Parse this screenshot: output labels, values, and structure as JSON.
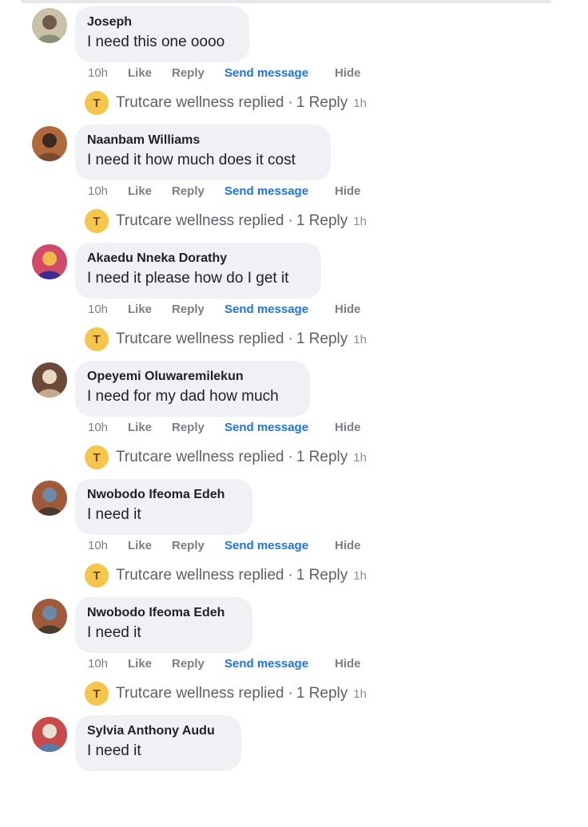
{
  "colors": {
    "bubble": "#eff1f4",
    "link": "#1d74e8",
    "meta": "#7b7e84",
    "reply_avatar": "#f6c54b"
  },
  "comments": [
    {
      "author": "Joseph",
      "text": "I need this one oooo",
      "time": "10h",
      "like": "Like",
      "reply": "Reply",
      "send_message": "Send message",
      "hide": "Hide",
      "reply_avatar_letter": "T",
      "reply_text": "Trutcare wellness replied",
      "reply_separator": "·",
      "reply_count": "1 Reply",
      "reply_time": "1h",
      "avatar_icon": "profile-photo-icon"
    },
    {
      "author": "Naanbam Williams",
      "text": "I need it how much does it cost",
      "time": "10h",
      "like": "Like",
      "reply": "Reply",
      "send_message": "Send message",
      "hide": "Hide",
      "reply_avatar_letter": "T",
      "reply_text": "Trutcare wellness replied",
      "reply_separator": "·",
      "reply_count": "1 Reply",
      "reply_time": "1h",
      "avatar_icon": "profile-photo-icon"
    },
    {
      "author": "Akaedu Nneka Dorathy",
      "text": "I need it please how do I get it",
      "time": "10h",
      "like": "Like",
      "reply": "Reply",
      "send_message": "Send message",
      "hide": "Hide",
      "reply_avatar_letter": "T",
      "reply_text": "Trutcare wellness replied",
      "reply_separator": "·",
      "reply_count": "1 Reply",
      "reply_time": "1h",
      "avatar_icon": "profile-photo-icon"
    },
    {
      "author": "Opeyemi Oluwaremilekun",
      "text": "I need for my dad how much",
      "time": "10h",
      "like": "Like",
      "reply": "Reply",
      "send_message": "Send message",
      "hide": "Hide",
      "reply_avatar_letter": "T",
      "reply_text": "Trutcare wellness replied",
      "reply_separator": "·",
      "reply_count": "1 Reply",
      "reply_time": "1h",
      "avatar_icon": "profile-photo-icon"
    },
    {
      "author": "Nwobodo Ifeoma Edeh",
      "text": "I need it",
      "time": "10h",
      "like": "Like",
      "reply": "Reply",
      "send_message": "Send message",
      "hide": "Hide",
      "reply_avatar_letter": "T",
      "reply_text": "Trutcare wellness replied",
      "reply_separator": "·",
      "reply_count": "1 Reply",
      "reply_time": "1h",
      "avatar_icon": "profile-photo-icon"
    },
    {
      "author": "Nwobodo Ifeoma Edeh",
      "text": "I need it",
      "time": "10h",
      "like": "Like",
      "reply": "Reply",
      "send_message": "Send message",
      "hide": "Hide",
      "reply_avatar_letter": "T",
      "reply_text": "Trutcare wellness replied",
      "reply_separator": "·",
      "reply_count": "1 Reply",
      "reply_time": "1h",
      "avatar_icon": "profile-photo-icon"
    },
    {
      "author": "Sylvia Anthony Audu",
      "text": "I need it",
      "avatar_icon": "profile-photo-icon"
    }
  ]
}
